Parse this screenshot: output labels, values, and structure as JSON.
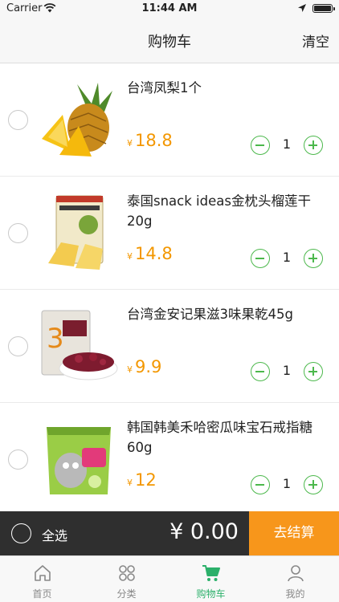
{
  "status_bar": {
    "carrier": "Carrier",
    "time": "11:44 AM"
  },
  "nav": {
    "title": "购物车",
    "clear_label": "清空"
  },
  "colors": {
    "accent_green": "#4cb84c",
    "price_orange": "#f39700",
    "checkout_orange": "#f7961b",
    "checkout_bar": "#2f2f2f"
  },
  "cart": {
    "items": [
      {
        "title": "台湾凤梨1个",
        "currency": "¥",
        "price": "18.8",
        "quantity": "1",
        "image": "pineapple-image"
      },
      {
        "title": "泰国snack ideas金枕头榴莲干20g",
        "currency": "¥",
        "price": "14.8",
        "quantity": "1",
        "image": "durian-snack-image"
      },
      {
        "title": "台湾金安记果滋3味果乾45g",
        "currency": "¥",
        "price": "9.9",
        "quantity": "1",
        "image": "dried-fruit-image"
      },
      {
        "title": "韩国韩美禾哈密瓜味宝石戒指糖60g",
        "currency": "¥",
        "price": "12",
        "quantity": "1",
        "image": "candy-pack-image"
      }
    ]
  },
  "checkout": {
    "select_all_label": "全选",
    "total": "¥ 0.00",
    "button_label": "去结算"
  },
  "tabs": [
    {
      "label": "首页",
      "icon": "home-icon",
      "active": false
    },
    {
      "label": "分类",
      "icon": "category-icon",
      "active": false
    },
    {
      "label": "购物车",
      "icon": "cart-icon",
      "active": true
    },
    {
      "label": "我的",
      "icon": "profile-icon",
      "active": false
    }
  ]
}
